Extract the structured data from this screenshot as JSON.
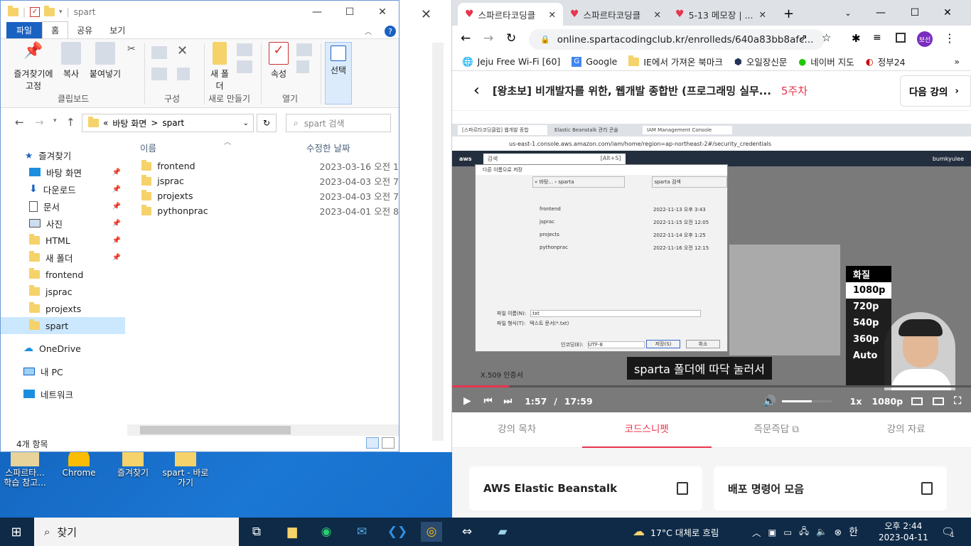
{
  "explorer": {
    "title": "spart",
    "tabs": [
      "파일",
      "홈",
      "공유",
      "보기"
    ],
    "ribbon": {
      "pin": "즐겨찾기에 고정",
      "copy": "복사",
      "paste": "붙여넣기",
      "new_folder": "새 폴더",
      "properties": "속성",
      "select": "선택",
      "groups": [
        "클립보드",
        "구성",
        "새로 만들기",
        "열기"
      ]
    },
    "path": [
      "«",
      "바탕 화면",
      ">",
      "spart"
    ],
    "search_placeholder": "spart 검색",
    "nav": [
      {
        "label": "즐겨찾기",
        "pin": ""
      },
      {
        "label": "바탕 화면",
        "pin": "📌"
      },
      {
        "label": "다운로드",
        "pin": "📌"
      },
      {
        "label": "문서",
        "pin": "📌"
      },
      {
        "label": "사진",
        "pin": "📌"
      },
      {
        "label": "HTML",
        "pin": "📌"
      },
      {
        "label": "새 폴더",
        "pin": "📌"
      },
      {
        "label": "frontend",
        "pin": ""
      },
      {
        "label": "jsprac",
        "pin": ""
      },
      {
        "label": "projexts",
        "pin": ""
      },
      {
        "label": "spart",
        "pin": ""
      },
      {
        "label": "OneDrive",
        "pin": ""
      },
      {
        "label": "내 PC",
        "pin": ""
      },
      {
        "label": "네트워크",
        "pin": ""
      }
    ],
    "col_name": "이름",
    "col_date": "수정한 날짜",
    "files": [
      {
        "name": "frontend",
        "date": "2023-03-16 오전 1"
      },
      {
        "name": "jsprac",
        "date": "2023-04-03 오전 7"
      },
      {
        "name": "projexts",
        "date": "2023-04-03 오전 7"
      },
      {
        "name": "pythonprac",
        "date": "2023-04-01 오전 8"
      }
    ],
    "status": "4개 항목"
  },
  "desktop_icons": [
    "스파르타... 학습 참고...",
    "Chrome",
    "즐겨찾기",
    "spart - 바로 가기"
  ],
  "chrome": {
    "tabs": [
      "스파르타코딩클",
      "스파르타코딩클",
      "5-13 메모장 | ..."
    ],
    "url": "online.spartacodingclub.kr/enrolleds/640a83bb8afc...",
    "profile": "보선",
    "bookmarks": [
      "Jeju Free Wi-Fi [60]",
      "Google",
      "IE에서 가져온 북마크",
      "오일장신문",
      "네이버 지도",
      "정부24"
    ],
    "course_title": "[왕초보] 비개발자를 위한, 웹개발 종합반 (프로그래밍 실무...",
    "week": "5주차",
    "next": "다음 강의",
    "video": {
      "inner_tabs": [
        "[스파르타코딩클럽] 웹개발 종합",
        "Elastic Beanstalk 관리 콘솔",
        "IAM Management Console"
      ],
      "inner_url": "us-east-1.console.aws.amazon.com/iam/home/region=ap-northeast-2#/security_credentials",
      "aws_search": "검색",
      "aws_shortcut": "[Alt+S]",
      "aws_user": "bumkyulee",
      "dialog_title": "다른 이름으로 저장",
      "dialog_path": "« 바탕... › sparta",
      "dialog_search": "sparta 검색",
      "dialog_files": [
        {
          "name": "frontend",
          "date": "2022-11-13 오후 3:43"
        },
        {
          "name": "jsprac",
          "date": "2022-11-15 오전 12:05"
        },
        {
          "name": "projects",
          "date": "2022-11-14 오후 1:25"
        },
        {
          "name": "pythonprac",
          "date": "2022-11-16 오전 12:15"
        }
      ],
      "dialog_filename_label": "파일 이름(N):",
      "dialog_filename": ".txt",
      "dialog_type_label": "파일 형식(T):",
      "dialog_type": "텍스트 문서(*.txt)",
      "dialog_encoding_label": "인코딩(E):",
      "dialog_encoding": "UTF-8",
      "dialog_save": "저장(S)",
      "dialog_cancel": "취소",
      "aws_text": "X.509 인증서",
      "quality_title": "화질",
      "quality_options": [
        "1080p",
        "720p",
        "540p",
        "360p",
        "Auto"
      ],
      "caption": "sparta 폴더에 따닥 눌러서",
      "time_current": "1:57",
      "time_sep": "/",
      "time_total": "17:59",
      "speed": "1x",
      "quality": "1080p",
      "progress": 0.109
    },
    "lecture_tabs": [
      "강의 목차",
      "코드스니펫",
      "즉문즉답",
      "강의 자료"
    ],
    "cards": [
      "AWS Elastic Beanstalk",
      "배포 명령어 모음"
    ]
  },
  "taskbar": {
    "search": "찾기",
    "weather": "17°C  대체로 흐림",
    "ime": "한",
    "time": "오후 2:44",
    "date": "2023-04-11",
    "notif": "1"
  }
}
